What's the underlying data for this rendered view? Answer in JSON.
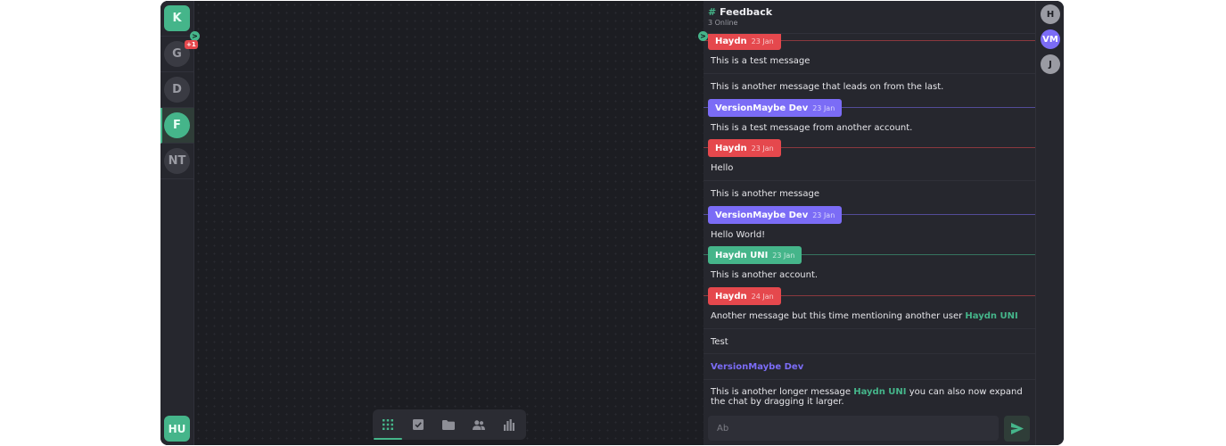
{
  "servers": [
    {
      "label": "K",
      "style": "green"
    },
    {
      "label": "G",
      "style": "grey"
    },
    {
      "label": "D",
      "style": "grey"
    },
    {
      "label": "F",
      "style": "active"
    },
    {
      "label": "NT",
      "style": "grey"
    }
  ],
  "server_badge": {
    "notification": ">",
    "count": "+1"
  },
  "user_avatar": "HU",
  "toolbar": {
    "tools": [
      {
        "icon": "grid-icon"
      },
      {
        "icon": "checkbox-icon"
      },
      {
        "icon": "folder-icon"
      },
      {
        "icon": "people-icon"
      },
      {
        "icon": "bar-chart-icon"
      }
    ],
    "active_index": 0
  },
  "channel": {
    "hash": "#",
    "name": "Feedback",
    "online": "3 Online"
  },
  "chat_expand": ">",
  "messages": [
    {
      "author": "Haydn",
      "date": "23 Jan",
      "color": "#e5484d",
      "lines": [
        "This is a test message",
        "This is another message that leads on from the last."
      ]
    },
    {
      "author": "VersionMaybe Dev",
      "date": "23 Jan",
      "color": "#7b6cf6",
      "lines": [
        "This is a test message from another account."
      ]
    },
    {
      "author": "Haydn",
      "date": "23 Jan",
      "color": "#e5484d",
      "lines": [
        "Hello",
        "This is another message"
      ]
    },
    {
      "author": "VersionMaybe Dev",
      "date": "23 Jan",
      "color": "#7b6cf6",
      "lines": [
        "Hello World!"
      ]
    },
    {
      "author": "Haydn UNI",
      "date": "23 Jan",
      "color": "#45b58a",
      "lines": [
        "This is another account."
      ]
    },
    {
      "author": "Haydn",
      "date": "24 Jan",
      "color": "#e5484d",
      "lines": []
    }
  ],
  "tail": {
    "mention_line_prefix": "Another message but this time mentioning another user ",
    "mention_user": "Haydn UNI",
    "test": "Test",
    "mention_vm": "VersionMaybe Dev",
    "long_prefix": "This is another longer message ",
    "long_mention": "Haydn UNI",
    "long_suffix": " you can also now expand the chat by dragging it larger."
  },
  "composer": {
    "placeholder": "Ab",
    "send_icon": "send-icon"
  },
  "members": [
    {
      "label": "H",
      "color": "#9a9ba3"
    },
    {
      "label": "VM",
      "color": "#7b6cf6"
    },
    {
      "label": "J",
      "color": "#9a9ba3"
    }
  ],
  "colors": {
    "accent": "#45b58a",
    "red": "#e5484d",
    "purple": "#7b6cf6"
  }
}
